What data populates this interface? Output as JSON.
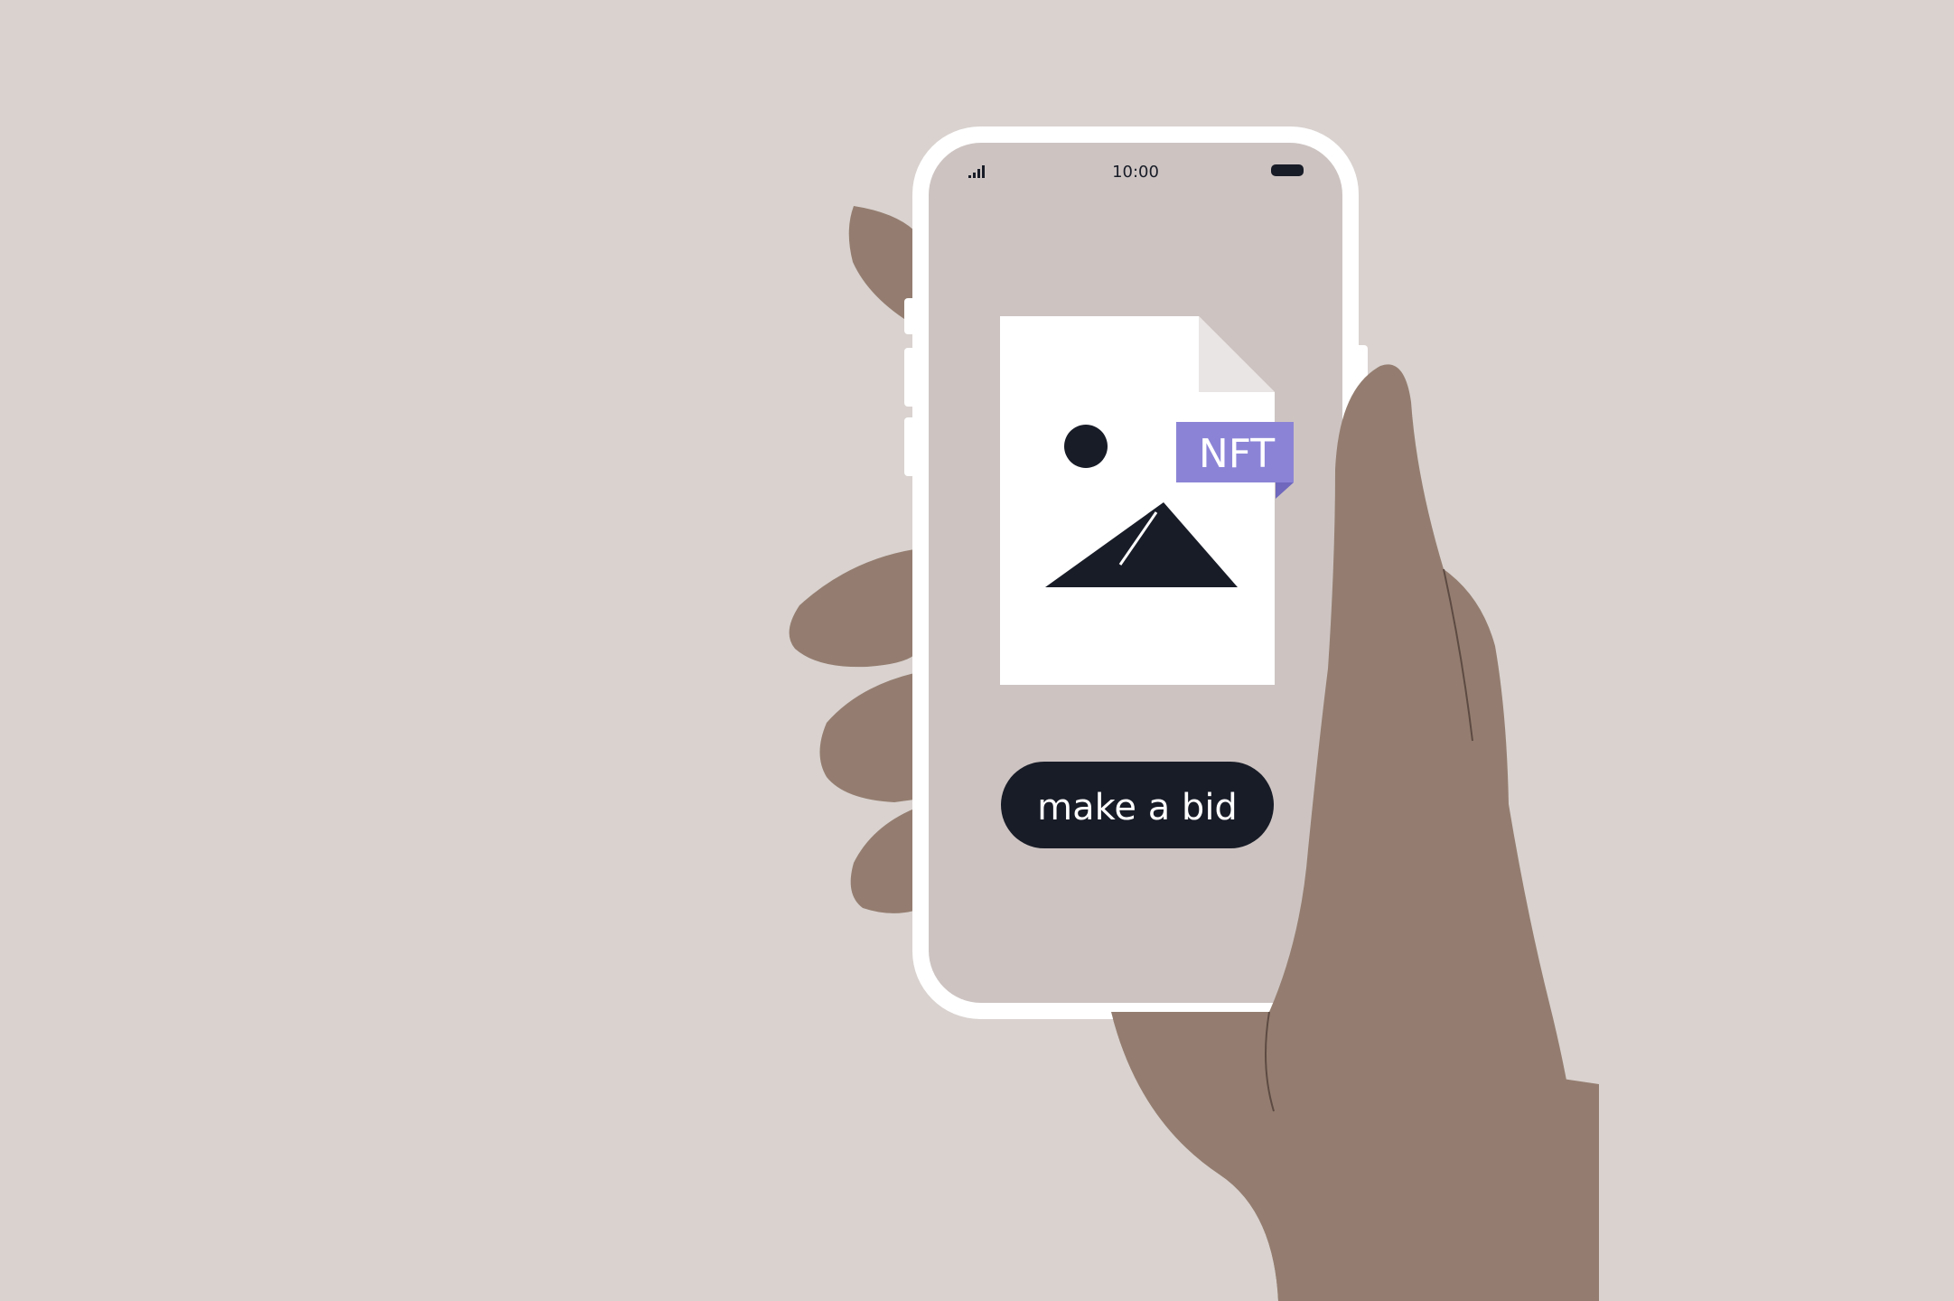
{
  "status_bar": {
    "time": "10:00",
    "signal_icon": "signal-bars-icon",
    "battery_icon": "battery-icon"
  },
  "nft_card": {
    "badge_label": "NFT",
    "image_icon": "image-placeholder-icon"
  },
  "actions": {
    "bid_label": "make a bid"
  },
  "colors": {
    "background": "#d9d2cf",
    "screen": "#cdc4c2",
    "phone_frame": "#ffffff",
    "skin": "#947d70",
    "badge": "#8b84d6",
    "button": "#181c27"
  }
}
